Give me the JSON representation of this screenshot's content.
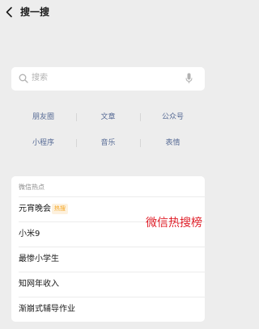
{
  "header": {
    "back_icon": "chevron-left-icon",
    "title": "搜一搜"
  },
  "search": {
    "placeholder": "搜索",
    "search_icon": "search-icon",
    "mic_icon": "microphone-icon"
  },
  "categories": [
    {
      "label": "朋友圈"
    },
    {
      "label": "文章"
    },
    {
      "label": "公众号"
    },
    {
      "label": "小程序"
    },
    {
      "label": "音乐"
    },
    {
      "label": "表情"
    }
  ],
  "hot": {
    "header": "微信热点",
    "items": [
      {
        "text": "元宵晚会",
        "badge": "热搜"
      },
      {
        "text": "小米9"
      },
      {
        "text": "最惨小学生"
      },
      {
        "text": "知网年收入"
      },
      {
        "text": "渐崩式辅导作业"
      }
    ]
  },
  "annotation": {
    "text": "微信热搜榜"
  },
  "colors": {
    "background": "#ededed",
    "link_blue": "#576b95",
    "annotation_red": "#e0202a",
    "badge_orange": "#f5a623"
  }
}
